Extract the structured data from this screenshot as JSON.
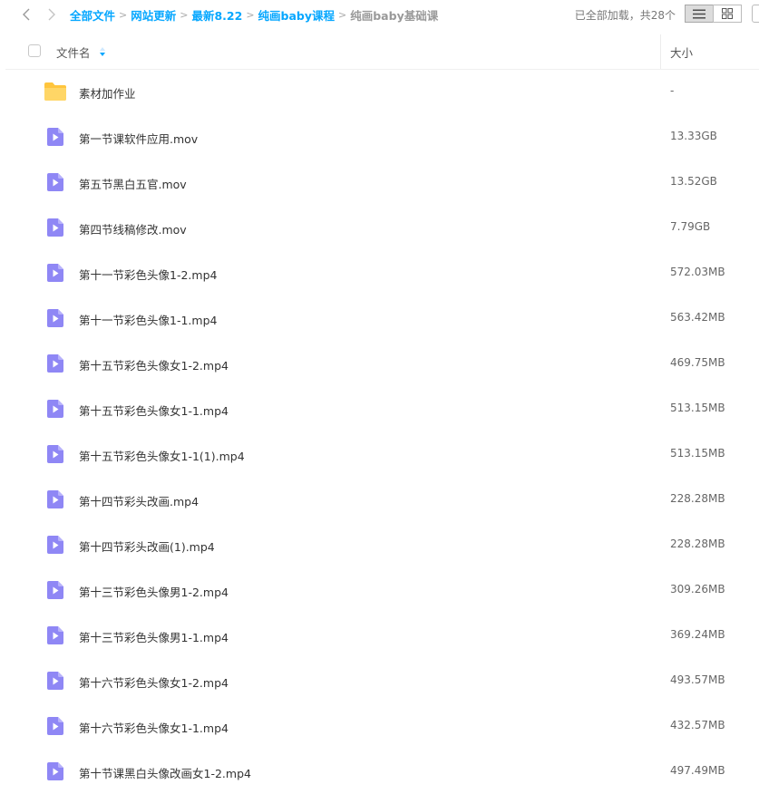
{
  "breadcrumb": [
    "全部文件",
    "网站更新",
    "最新8.22",
    "纯画baby课程",
    "纯画baby基础课"
  ],
  "status": {
    "loaded_text": "已全部加载，共28个"
  },
  "header": {
    "name_label": "文件名",
    "size_label": "大小"
  },
  "colors": {
    "accent": "#06a7ff",
    "video_icon": "#8f87f5",
    "folder": "#ffc53d"
  },
  "files": [
    {
      "name": "素材加作业",
      "size": "-",
      "type": "folder"
    },
    {
      "name": "第一节课软件应用.mov",
      "size": "13.33GB",
      "type": "video"
    },
    {
      "name": "第五节黑白五官.mov",
      "size": "13.52GB",
      "type": "video"
    },
    {
      "name": "第四节线稿修改.mov",
      "size": "7.79GB",
      "type": "video"
    },
    {
      "name": "第十一节彩色头像1-2.mp4",
      "size": "572.03MB",
      "type": "video"
    },
    {
      "name": "第十一节彩色头像1-1.mp4",
      "size": "563.42MB",
      "type": "video"
    },
    {
      "name": "第十五节彩色头像女1-2.mp4",
      "size": "469.75MB",
      "type": "video"
    },
    {
      "name": "第十五节彩色头像女1-1.mp4",
      "size": "513.15MB",
      "type": "video"
    },
    {
      "name": "第十五节彩色头像女1-1(1).mp4",
      "size": "513.15MB",
      "type": "video"
    },
    {
      "name": "第十四节彩头改画.mp4",
      "size": "228.28MB",
      "type": "video"
    },
    {
      "name": "第十四节彩头改画(1).mp4",
      "size": "228.28MB",
      "type": "video"
    },
    {
      "name": "第十三节彩色头像男1-2.mp4",
      "size": "309.26MB",
      "type": "video"
    },
    {
      "name": "第十三节彩色头像男1-1.mp4",
      "size": "369.24MB",
      "type": "video"
    },
    {
      "name": "第十六节彩色头像女1-2.mp4",
      "size": "493.57MB",
      "type": "video"
    },
    {
      "name": "第十六节彩色头像女1-1.mp4",
      "size": "432.57MB",
      "type": "video"
    },
    {
      "name": "第十节课黑白头像改画女1-2.mp4",
      "size": "497.49MB",
      "type": "video"
    }
  ]
}
